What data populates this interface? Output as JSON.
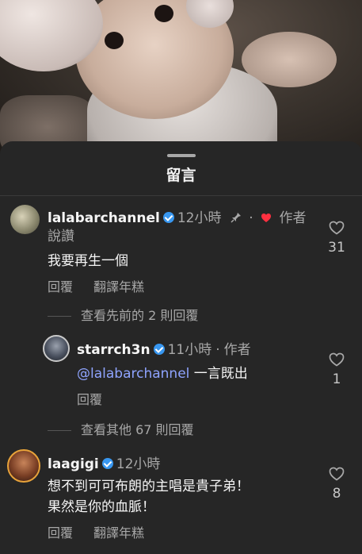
{
  "sheet": {
    "title": "留言"
  },
  "comments": [
    {
      "username": "lalabarchannel",
      "time": "12小時",
      "pin_icon": "pin-icon",
      "author_liked": "作者",
      "author_liked_line2": "說讚",
      "text": "我要再生一個",
      "actions": [
        "回覆",
        "翻譯年糕"
      ],
      "likes": "31",
      "heart_color": "#ff3040"
    },
    {
      "view_previous": "查看先前的 2 則回覆"
    },
    {
      "username": "starrch3n",
      "time": "11小時",
      "author": "作者",
      "mention": "@lalabarchannel",
      "text": " 一言既出",
      "actions": [
        "回覆"
      ],
      "likes": "1"
    },
    {
      "view_more": "查看其他 67 則回覆"
    },
    {
      "username": "laagigi",
      "time": "12小時",
      "text_line1": "想不到可可布朗的主唱是貴子弟！",
      "text_line2": "果然是你的血脈！",
      "actions": [
        "回覆",
        "翻譯年糕"
      ],
      "likes": "8"
    }
  ],
  "colors": {
    "sheet_bg": "#262626",
    "secondary_text": "#a8a8a8",
    "verified": "#3897f0",
    "mention": "#8fa4ff"
  }
}
